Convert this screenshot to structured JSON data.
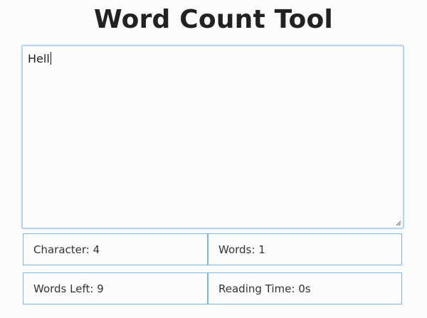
{
  "header": {
    "title": "Word Count Tool"
  },
  "editor": {
    "value": "Hell"
  },
  "stats": {
    "character_label": "Character:",
    "character_value": "4",
    "words_label": "Words:",
    "words_value": "1",
    "words_left_label": "Words Left:",
    "words_left_value": "9",
    "reading_time_label": "Reading Time:",
    "reading_time_value": "0s"
  },
  "colors": {
    "editor_border": "#b9d3f0",
    "stats_border": "#7bb7e6",
    "title_text": "#222222"
  },
  "icons": {
    "resize_grip": "resize-grip-icon"
  }
}
